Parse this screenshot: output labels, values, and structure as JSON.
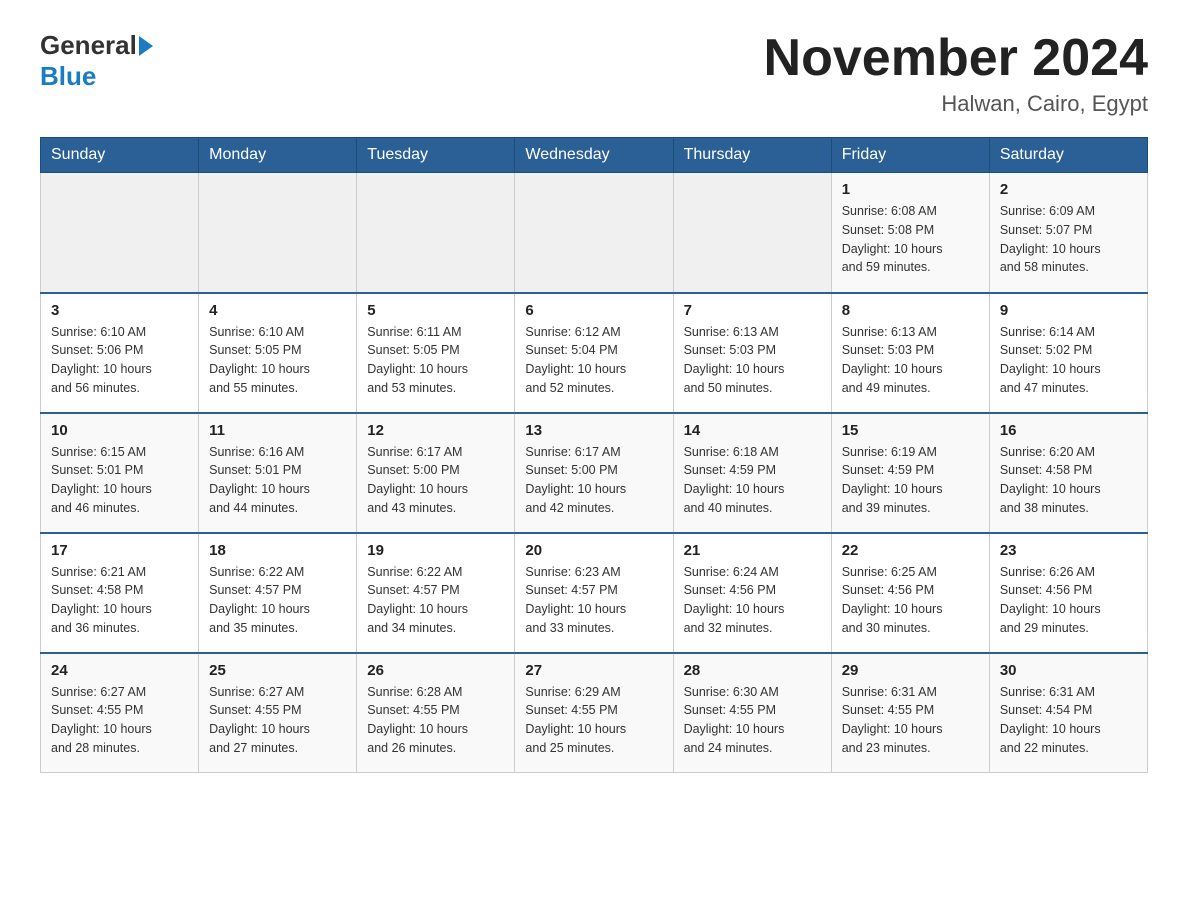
{
  "header": {
    "logo_general": "General",
    "logo_blue": "Blue",
    "month_title": "November 2024",
    "location": "Halwan, Cairo, Egypt"
  },
  "days_of_week": [
    "Sunday",
    "Monday",
    "Tuesday",
    "Wednesday",
    "Thursday",
    "Friday",
    "Saturday"
  ],
  "weeks": [
    [
      {
        "day": "",
        "info": ""
      },
      {
        "day": "",
        "info": ""
      },
      {
        "day": "",
        "info": ""
      },
      {
        "day": "",
        "info": ""
      },
      {
        "day": "",
        "info": ""
      },
      {
        "day": "1",
        "info": "Sunrise: 6:08 AM\nSunset: 5:08 PM\nDaylight: 10 hours\nand 59 minutes."
      },
      {
        "day": "2",
        "info": "Sunrise: 6:09 AM\nSunset: 5:07 PM\nDaylight: 10 hours\nand 58 minutes."
      }
    ],
    [
      {
        "day": "3",
        "info": "Sunrise: 6:10 AM\nSunset: 5:06 PM\nDaylight: 10 hours\nand 56 minutes."
      },
      {
        "day": "4",
        "info": "Sunrise: 6:10 AM\nSunset: 5:05 PM\nDaylight: 10 hours\nand 55 minutes."
      },
      {
        "day": "5",
        "info": "Sunrise: 6:11 AM\nSunset: 5:05 PM\nDaylight: 10 hours\nand 53 minutes."
      },
      {
        "day": "6",
        "info": "Sunrise: 6:12 AM\nSunset: 5:04 PM\nDaylight: 10 hours\nand 52 minutes."
      },
      {
        "day": "7",
        "info": "Sunrise: 6:13 AM\nSunset: 5:03 PM\nDaylight: 10 hours\nand 50 minutes."
      },
      {
        "day": "8",
        "info": "Sunrise: 6:13 AM\nSunset: 5:03 PM\nDaylight: 10 hours\nand 49 minutes."
      },
      {
        "day": "9",
        "info": "Sunrise: 6:14 AM\nSunset: 5:02 PM\nDaylight: 10 hours\nand 47 minutes."
      }
    ],
    [
      {
        "day": "10",
        "info": "Sunrise: 6:15 AM\nSunset: 5:01 PM\nDaylight: 10 hours\nand 46 minutes."
      },
      {
        "day": "11",
        "info": "Sunrise: 6:16 AM\nSunset: 5:01 PM\nDaylight: 10 hours\nand 44 minutes."
      },
      {
        "day": "12",
        "info": "Sunrise: 6:17 AM\nSunset: 5:00 PM\nDaylight: 10 hours\nand 43 minutes."
      },
      {
        "day": "13",
        "info": "Sunrise: 6:17 AM\nSunset: 5:00 PM\nDaylight: 10 hours\nand 42 minutes."
      },
      {
        "day": "14",
        "info": "Sunrise: 6:18 AM\nSunset: 4:59 PM\nDaylight: 10 hours\nand 40 minutes."
      },
      {
        "day": "15",
        "info": "Sunrise: 6:19 AM\nSunset: 4:59 PM\nDaylight: 10 hours\nand 39 minutes."
      },
      {
        "day": "16",
        "info": "Sunrise: 6:20 AM\nSunset: 4:58 PM\nDaylight: 10 hours\nand 38 minutes."
      }
    ],
    [
      {
        "day": "17",
        "info": "Sunrise: 6:21 AM\nSunset: 4:58 PM\nDaylight: 10 hours\nand 36 minutes."
      },
      {
        "day": "18",
        "info": "Sunrise: 6:22 AM\nSunset: 4:57 PM\nDaylight: 10 hours\nand 35 minutes."
      },
      {
        "day": "19",
        "info": "Sunrise: 6:22 AM\nSunset: 4:57 PM\nDaylight: 10 hours\nand 34 minutes."
      },
      {
        "day": "20",
        "info": "Sunrise: 6:23 AM\nSunset: 4:57 PM\nDaylight: 10 hours\nand 33 minutes."
      },
      {
        "day": "21",
        "info": "Sunrise: 6:24 AM\nSunset: 4:56 PM\nDaylight: 10 hours\nand 32 minutes."
      },
      {
        "day": "22",
        "info": "Sunrise: 6:25 AM\nSunset: 4:56 PM\nDaylight: 10 hours\nand 30 minutes."
      },
      {
        "day": "23",
        "info": "Sunrise: 6:26 AM\nSunset: 4:56 PM\nDaylight: 10 hours\nand 29 minutes."
      }
    ],
    [
      {
        "day": "24",
        "info": "Sunrise: 6:27 AM\nSunset: 4:55 PM\nDaylight: 10 hours\nand 28 minutes."
      },
      {
        "day": "25",
        "info": "Sunrise: 6:27 AM\nSunset: 4:55 PM\nDaylight: 10 hours\nand 27 minutes."
      },
      {
        "day": "26",
        "info": "Sunrise: 6:28 AM\nSunset: 4:55 PM\nDaylight: 10 hours\nand 26 minutes."
      },
      {
        "day": "27",
        "info": "Sunrise: 6:29 AM\nSunset: 4:55 PM\nDaylight: 10 hours\nand 25 minutes."
      },
      {
        "day": "28",
        "info": "Sunrise: 6:30 AM\nSunset: 4:55 PM\nDaylight: 10 hours\nand 24 minutes."
      },
      {
        "day": "29",
        "info": "Sunrise: 6:31 AM\nSunset: 4:55 PM\nDaylight: 10 hours\nand 23 minutes."
      },
      {
        "day": "30",
        "info": "Sunrise: 6:31 AM\nSunset: 4:54 PM\nDaylight: 10 hours\nand 22 minutes."
      }
    ]
  ]
}
